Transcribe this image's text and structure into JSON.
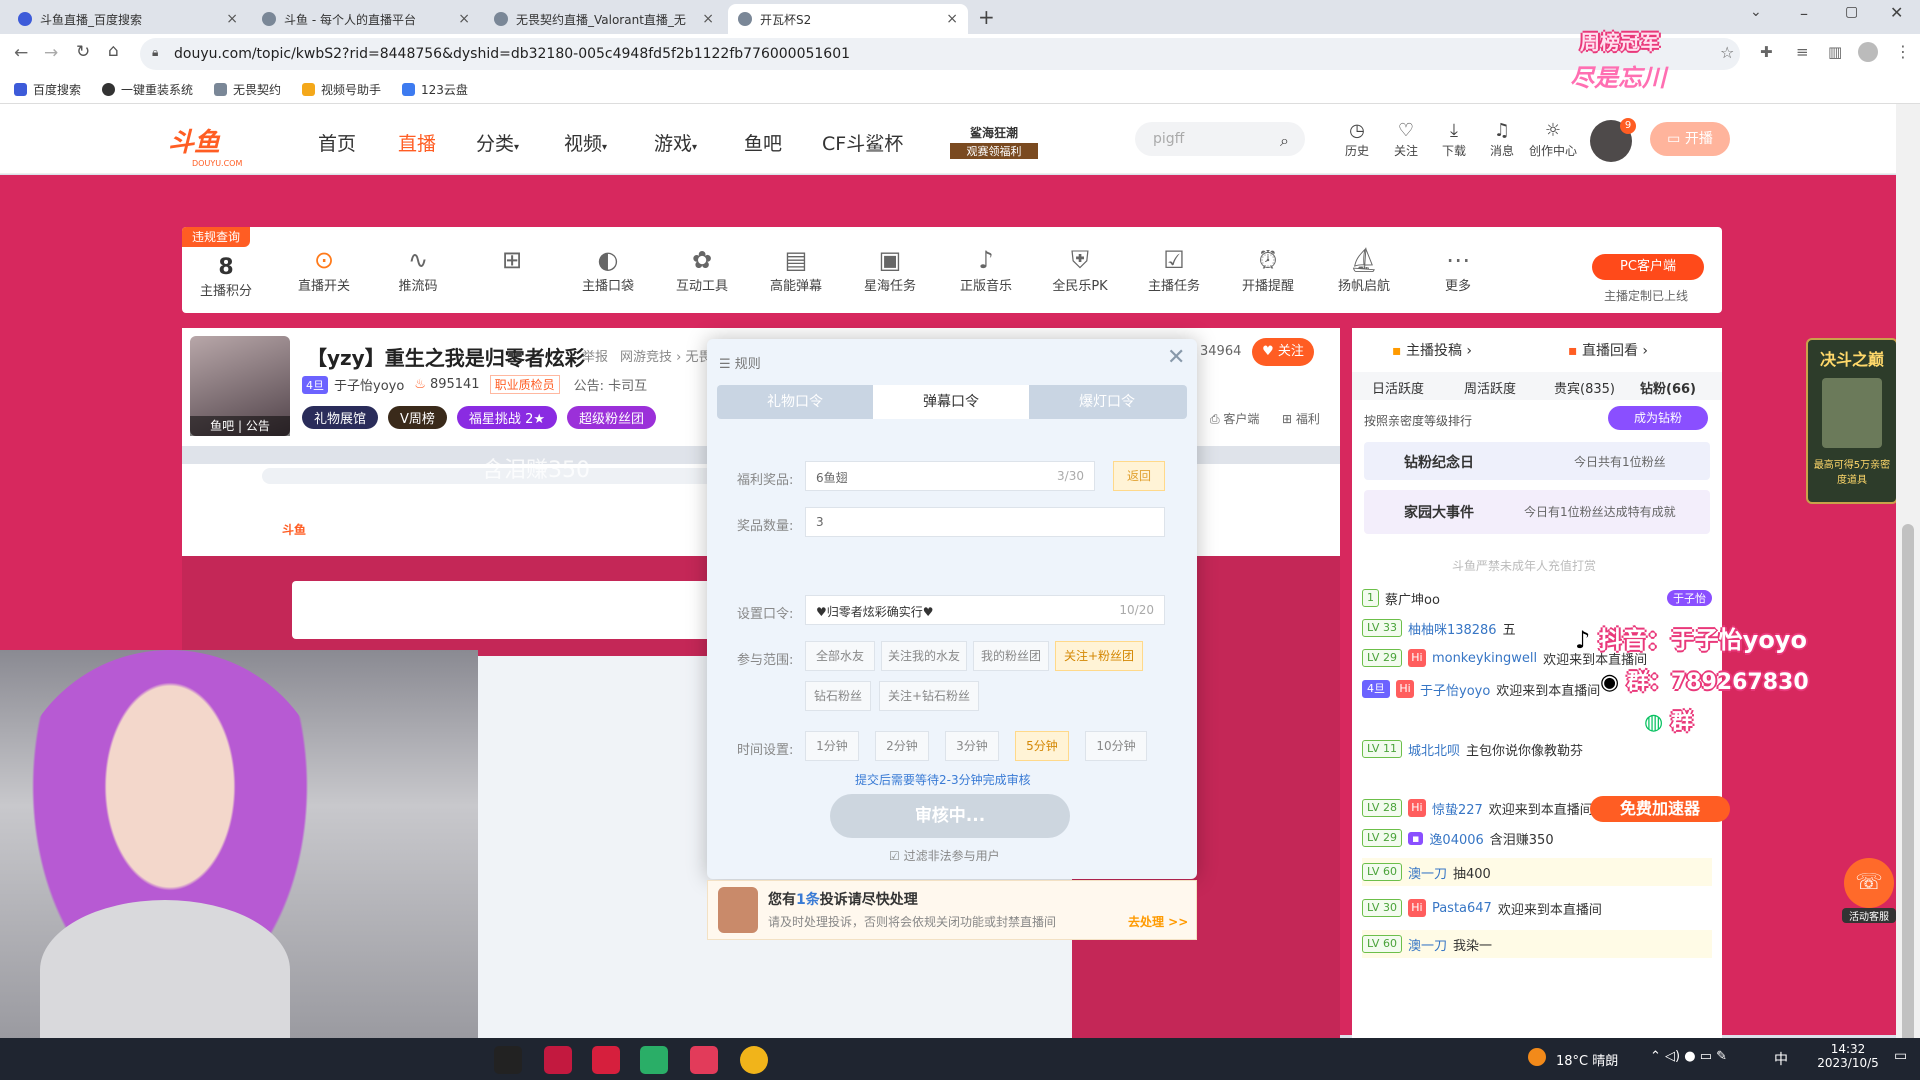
{
  "tabs": [
    {
      "title": "斗鱼直播_百度搜索"
    },
    {
      "title": "斗鱼 - 每个人的直播平台"
    },
    {
      "title": "无畏契约直播_Valorant直播_无"
    },
    {
      "title": "开瓦杯S2"
    }
  ],
  "address": {
    "url": "douyu.com/topic/kwbS2?rid=8448756&dyshid=db32180-005c4948fd5f2b1122fb776000051601"
  },
  "bookmarks": [
    "百度搜索",
    "一键重装系统",
    "无畏契约",
    "视频号助手",
    "123云盘"
  ],
  "header": {
    "logo": "斗鱼",
    "logo_sub": "DOUYU.COM",
    "nav": [
      "首页",
      "直播",
      "分类",
      "视频",
      "游戏",
      "鱼吧",
      "CF斗鲨杯"
    ],
    "promo_top": "鲨海狂潮",
    "promo_bottom": "观赛领福利",
    "search_placeholder": "pigff",
    "icons": [
      {
        "label": "历史",
        "icon": "clock-icon"
      },
      {
        "label": "关注",
        "icon": "heart-icon"
      },
      {
        "label": "下载",
        "icon": "download-icon"
      },
      {
        "label": "消息",
        "icon": "bell-icon"
      },
      {
        "label": "创作中心",
        "icon": "bulb-icon"
      }
    ],
    "avatar_badge": "9",
    "open_live": "开播"
  },
  "toolbar": {
    "violation_tag": "违规查询",
    "score": "8",
    "score_label": "主播积分",
    "items": [
      "直播开关",
      "推流码",
      "",
      "主播口袋",
      "互动工具",
      "高能弹幕",
      "星海任务",
      "正版音乐",
      "全民乐PK",
      "主播任务",
      "开播提醒",
      "扬帆启航",
      "更多"
    ],
    "pc_client": "PC客户端",
    "pc_client_sub": "主播定制已上线"
  },
  "room": {
    "title": "【yzy】重生之我是归零者炫彩",
    "report": "举报",
    "category": "网游竞技 › 无畏",
    "level": "4旦",
    "streamer": "于子怡yoyo",
    "heat": "895141",
    "badge": "职业质检员",
    "announcement": "公告: 卡司互",
    "fans_count": "34964",
    "follow": "关注",
    "avatar_caption": "鱼吧 | 公告",
    "pills": [
      "礼物展馆",
      "V周榜",
      "福星挑战",
      "超级粉丝团"
    ],
    "challenge_count": "2",
    "client_link": "客户端",
    "welfare_link": "福利",
    "overlay_text": "含泪赚350"
  },
  "modal": {
    "title": "规则",
    "tabs": [
      "礼物口令",
      "弹幕口令",
      "爆灯口令"
    ],
    "active_tab": 1,
    "prize_label": "福利奖品:",
    "prize_value": "6鱼翅",
    "prize_count": "3/30",
    "prize_btn": "返回",
    "qty_label": "奖品数量:",
    "qty_value": "3",
    "code_label": "设置口令:",
    "code_value": "♥归零者炫彩确实行♥",
    "code_count": "10/20",
    "scope_label": "参与范围:",
    "scope_options": [
      "全部水友",
      "关注我的水友",
      "我的粉丝团",
      "关注+粉丝团",
      "钻石粉丝",
      "关注+钻石粉丝"
    ],
    "scope_selected": "关注+粉丝团",
    "time_label": "时间设置:",
    "time_options": [
      "1分钟",
      "2分钟",
      "3分钟",
      "5分钟",
      "10分钟"
    ],
    "time_selected": "5分钟",
    "hint": "提交后需要等待2-3分钟完成审核",
    "review_btn": "审核中...",
    "filter": "过滤非法参与用户"
  },
  "notice": {
    "title_pre": "您有",
    "title_num": "1条",
    "title_post": "投诉请尽快处理",
    "body": "请及时处理投诉，否则将会依规关闭功能或封禁直播间",
    "action": "去处理 >>"
  },
  "right_panel": {
    "tab_submit": "主播投稿",
    "tab_replay": "直播回看",
    "rank_tabs": [
      "日活跃度",
      "周活跃度",
      "贵宾(835)",
      "钻粉(66)"
    ],
    "rank_hint": "按照亲密度等级排行",
    "become_diamond": "成为钻粉",
    "diamond_memorial": "钻粉纪念日",
    "diamond_memorial_sub": "今日共有1位粉丝",
    "family_event": "家园大事件",
    "family_event_sub": "今日有1位粉丝达成特有成就",
    "warning": "斗鱼严禁未成年人充值打赏",
    "chat": [
      {
        "lv": "1",
        "user": "蔡广坤oo",
        "msg": ""
      },
      {
        "lv": "LV 33",
        "user": "柚柚咪138286",
        "msg": "五"
      },
      {
        "lv": "LV 29",
        "user": "monkeykingwell",
        "msg": "欢迎来到本直播间"
      },
      {
        "lv": "4旦",
        "user": "于子怡yoyo",
        "msg": "欢迎来到本直播间"
      },
      {
        "lv": "LV 11",
        "user": "城北北呗",
        "msg": "主包你说你像教勒芬"
      },
      {
        "lv": "LV 28",
        "user": "惊蛰227",
        "msg": "欢迎来到本直播间"
      },
      {
        "lv": "LV 29",
        "user": "逸04006",
        "msg": "含泪赚350"
      },
      {
        "lv": "LV 60",
        "user": "澳一刀",
        "msg": "抽400"
      },
      {
        "lv": "LV 30",
        "user": "Pasta647",
        "msg": "欢迎来到本直播间"
      },
      {
        "lv": "LV 60",
        "user": "澳一刀",
        "msg": "我染一"
      }
    ],
    "badge_user": "于子怡"
  },
  "overlays": {
    "tiktok": "抖音：于子怡yoyo",
    "qq": "群：789267830",
    "wechat": "群",
    "speed": "免费加速器",
    "corner_top": "周榜冠军",
    "corner_bottom": "尽是忘川",
    "battle_title": "决斗之巅",
    "battle_sub": "最高可得5万亲密度道具",
    "service": "活动客服"
  },
  "taskbar": {
    "weather": "18°C 晴朗",
    "ime": "中",
    "time": "14:32",
    "date": "2023/10/5"
  }
}
